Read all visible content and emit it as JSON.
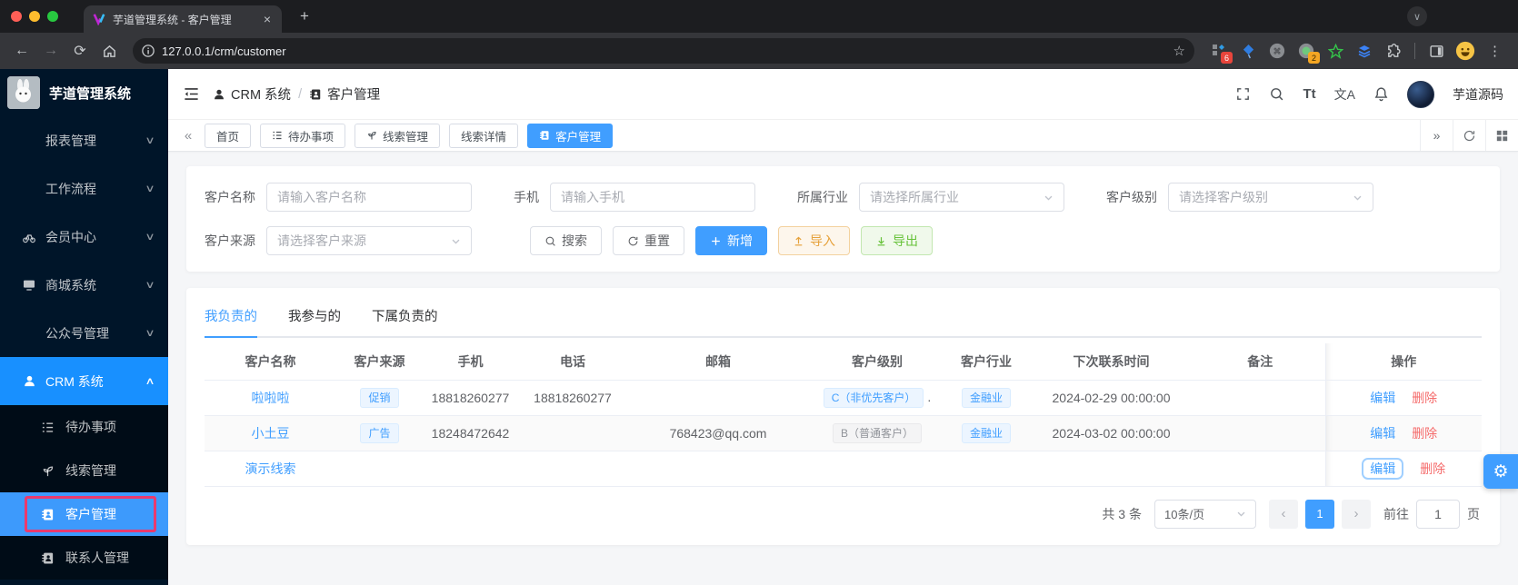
{
  "browser": {
    "tab_title": "芋道管理系统 - 客户管理",
    "close_glyph": "×",
    "new_tab_glyph": "+",
    "url": "127.0.0.1/crm/customer",
    "back_glyph": "←",
    "forward_glyph": "→",
    "reload_glyph": "⟳",
    "star_glyph": "☆",
    "menu_glyph": "⋮",
    "tabsearch_glyph": "∨",
    "extension_badges": {
      "adblock": "6",
      "profileish": "2"
    }
  },
  "sidebar": {
    "logo_text": "芋道管理系统",
    "items": [
      {
        "label": "报表管理"
      },
      {
        "label": "工作流程"
      },
      {
        "label": "会员中心"
      },
      {
        "label": "商城系统"
      },
      {
        "label": "公众号管理"
      },
      {
        "label": "CRM 系统"
      }
    ],
    "submenu": [
      {
        "label": "待办事项"
      },
      {
        "label": "线索管理"
      },
      {
        "label": "客户管理"
      },
      {
        "label": "联系人管理"
      }
    ],
    "chevron_down": "∨",
    "chevron_up": "∧"
  },
  "header": {
    "breadcrumb_1": "CRM 系统",
    "breadcrumb_sep": "/",
    "breadcrumb_2": "客户管理",
    "font_toggle": "Tt",
    "lang_toggle": "文A",
    "user_name": "芋道源码"
  },
  "tagsbar": {
    "left_arrow": "«",
    "right_arrow": "»",
    "tabs": [
      {
        "label": "首页"
      },
      {
        "label": "待办事项"
      },
      {
        "label": "线索管理"
      },
      {
        "label": "线索详情"
      },
      {
        "label": "客户管理"
      }
    ],
    "active_tab": "客户管理"
  },
  "filters": {
    "fields": [
      {
        "label": "客户名称",
        "placeholder": "请输入客户名称"
      },
      {
        "label": "手机",
        "placeholder": "请输入手机"
      },
      {
        "label": "所属行业",
        "placeholder": "请选择所属行业"
      },
      {
        "label": "客户级别",
        "placeholder": "请选择客户级别"
      },
      {
        "label": "客户来源",
        "placeholder": "请选择客户来源"
      }
    ],
    "buttons": {
      "search": "搜索",
      "reset": "重置",
      "add": "新增",
      "import": "导入",
      "export": "导出"
    }
  },
  "content_tabs": {
    "tabs": [
      {
        "label": "我负责的"
      },
      {
        "label": "我参与的"
      },
      {
        "label": "下属负责的"
      }
    ],
    "active_tab": "我负责的"
  },
  "table": {
    "headers": [
      "客户名称",
      "客户来源",
      "手机",
      "电话",
      "邮箱",
      "客户级别",
      "客户行业",
      "下次联系时间",
      "备注",
      "操作"
    ],
    "rows": [
      {
        "name": "啦啦啦",
        "source": "促销",
        "mobile": "18818260277",
        "phone": "18818260277",
        "email": "",
        "level": "C（非优先客户）",
        "level_suffix": ".",
        "industry": "金融业",
        "next_time": "2024-02-29 00:00:00",
        "remark": ""
      },
      {
        "name": "小土豆",
        "source": "广告",
        "mobile": "18248472642",
        "phone": "",
        "email": "768423@qq.com",
        "level": "B（普通客户）",
        "industry": "金融业",
        "next_time": "2024-03-02 00:00:00",
        "remark": ""
      },
      {
        "name": "演示线索",
        "source": "",
        "mobile": "",
        "phone": "",
        "email": "",
        "level": "",
        "industry": "",
        "next_time": "",
        "remark": ""
      }
    ],
    "actions": {
      "edit": "编辑",
      "delete": "删除"
    }
  },
  "pagination": {
    "total": "共 3 条",
    "page_size": "10条/页",
    "prev_glyph": "‹",
    "next_glyph": "›",
    "current_page": "1",
    "goto_label": "前往",
    "goto_value": "1",
    "unit": "页"
  },
  "colors": {
    "accent": "#409eff",
    "sidebar_bg": "#001529",
    "sidebar_active": "#1890ff",
    "annotation": "#ea3a6e",
    "danger": "#f56c6c",
    "warning": "#e6a23c",
    "success": "#67c23a"
  }
}
